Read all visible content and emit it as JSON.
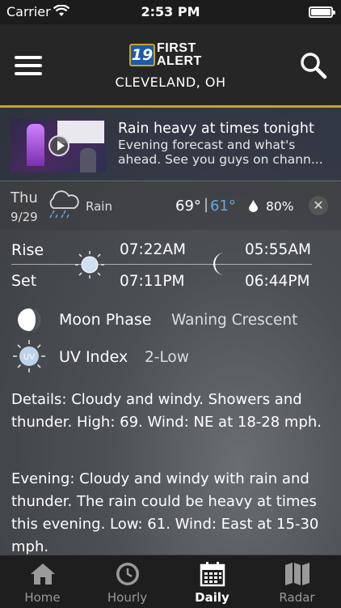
{
  "status_bar": {
    "carrier": "Carrier",
    "time": "2:53 PM"
  },
  "header": {
    "logo_number": "19",
    "logo_line1": "FIRST",
    "logo_line2": "ALERT",
    "city": "CLEVELAND, OH"
  },
  "video": {
    "title": "Rain heavy at times tonight",
    "description": "Evening forecast and what's ahead.  See you guys on chann..."
  },
  "forecast": {
    "day": "Thu",
    "date": "9/29",
    "condition": "Rain",
    "high": "69°",
    "separator": "|",
    "low": "61°",
    "precip": "80%",
    "close": "✕"
  },
  "sun_moon": {
    "rise_label": "Rise",
    "set_label": "Set",
    "sunrise": "07:22AM",
    "sunset": "07:11PM",
    "moonrise": "05:55AM",
    "moonset": "06:44PM"
  },
  "moon_phase": {
    "label": "Moon Phase",
    "value": "Waning Crescent"
  },
  "uv": {
    "label": "UV Index",
    "value": "2-Low",
    "icon_text": "UV"
  },
  "details": "Details: Cloudy and windy.  Showers and thunder.  High: 69.  Wind: NE at 18-28 mph.",
  "evening": "Evening: Cloudy and windy with rain and thunder.  The rain could be heavy at times this evening.  Low: 61.  Wind: East at 15-30 mph.",
  "tabs": [
    {
      "label": "Home",
      "icon": "home-icon"
    },
    {
      "label": "Hourly",
      "icon": "clock-icon"
    },
    {
      "label": "Daily",
      "icon": "calendar-icon"
    },
    {
      "label": "Radar",
      "icon": "map-icon"
    }
  ],
  "colors": {
    "accent_gold": "#c8a22a",
    "low_temp_blue": "#69a6e0"
  }
}
